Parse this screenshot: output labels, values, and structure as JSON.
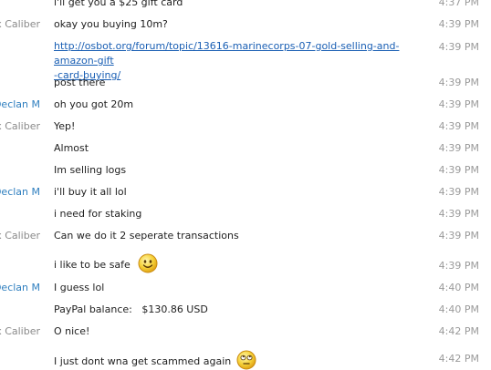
{
  "messages": [
    {
      "sender": "",
      "text": "i'll get you a $25 gift card",
      "time": "4:37 PM"
    },
    {
      "sender": "x Caliber",
      "text": "okay you buying 10m?",
      "time": "4:39 PM"
    },
    {
      "sender": "",
      "text": "http://osbot.org/forum/topic/13616-marinecorps-07-gold-selling-and-amazon-gift-card-buying/",
      "line1": "http://osbot.org/forum/topic/13616-marinecorps-07-gold-selling-and-amazon-gift",
      "line2": "-card-buying/",
      "time": "4:39 PM"
    },
    {
      "sender": "",
      "text": "post there",
      "time": "4:39 PM"
    },
    {
      "sender": "Declan M",
      "text": "oh you got 20m",
      "time": "4:39 PM"
    },
    {
      "sender": "x Caliber",
      "text": "Yep!",
      "time": "4:39 PM"
    },
    {
      "sender": "",
      "text": "Almost",
      "time": "4:39 PM"
    },
    {
      "sender": "",
      "text": "Im selling logs",
      "time": "4:39 PM"
    },
    {
      "sender": "Declan M",
      "text": "i'll buy it all lol",
      "time": "4:39 PM"
    },
    {
      "sender": "",
      "text": "i need for staking",
      "time": "4:39 PM"
    },
    {
      "sender": "x Caliber",
      "text": "Can we do it 2 seperate transactions",
      "time": "4:39 PM"
    },
    {
      "sender": "",
      "text": "i like to be safe",
      "emoticon": "smile-emoticon",
      "time": "4:39 PM"
    },
    {
      "sender": "Declan M",
      "text": "I guess lol",
      "time": "4:40 PM"
    },
    {
      "sender": "",
      "text": "PayPal balance:   $130.86 USD",
      "time": "4:40 PM"
    },
    {
      "sender": "x Caliber",
      "text": "O nice!",
      "time": "4:42 PM"
    },
    {
      "sender": "",
      "text": "I just dont wna get scammed again",
      "emoticon": "eye-roll-emoticon",
      "time": "4:42 PM"
    }
  ]
}
